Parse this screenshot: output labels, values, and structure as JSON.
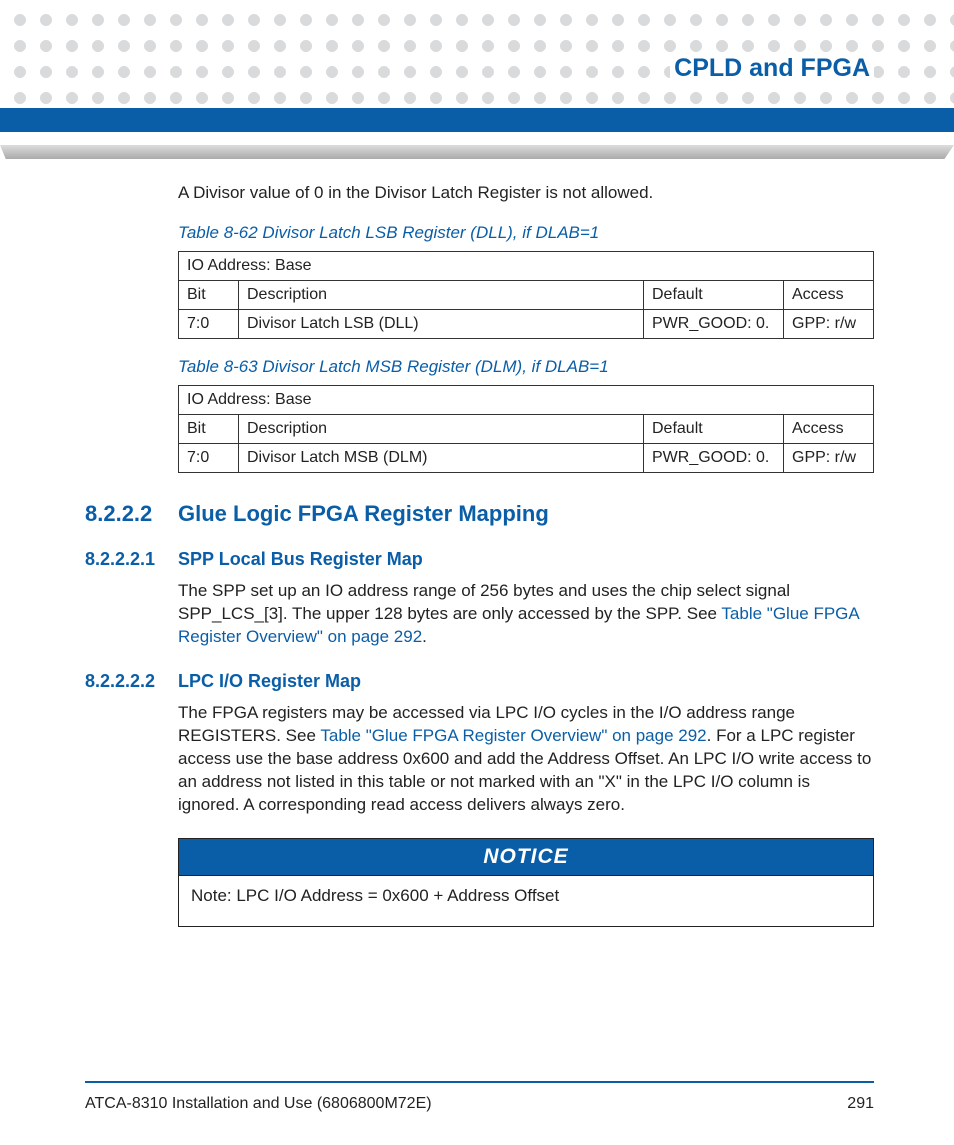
{
  "header": {
    "chapter": "CPLD and FPGA"
  },
  "intro": "A Divisor value of 0 in the Divisor Latch Register is not allowed.",
  "table62": {
    "caption": "Table 8-62 Divisor Latch LSB Register (DLL), if DLAB=1",
    "address_row": "IO Address: Base",
    "headers": {
      "bit": "Bit",
      "desc": "Description",
      "def": "Default",
      "acc": "Access"
    },
    "row": {
      "bit": "7:0",
      "desc": "Divisor Latch LSB (DLL)",
      "def": "PWR_GOOD: 0.",
      "acc": "GPP: r/w"
    }
  },
  "table63": {
    "caption": "Table 8-63 Divisor Latch MSB Register (DLM), if DLAB=1",
    "address_row": "IO Address: Base",
    "headers": {
      "bit": "Bit",
      "desc": "Description",
      "def": "Default",
      "acc": "Access"
    },
    "row": {
      "bit": "7:0",
      "desc": "Divisor Latch MSB (DLM)",
      "def": "PWR_GOOD: 0.",
      "acc": "GPP: r/w"
    }
  },
  "sec8222": {
    "num": "8.2.2.2",
    "title": "Glue Logic FPGA Register Mapping"
  },
  "sec82221": {
    "num": "8.2.2.2.1",
    "title": "SPP Local Bus Register Map",
    "text1": "The SPP set up an IO address range of 256 bytes and uses the chip select signal SPP_LCS_[3]. The upper 128 bytes are only accessed by the SPP. See ",
    "link": "Table \"Glue FPGA Register Overview\" on page 292",
    "text2": "."
  },
  "sec82222": {
    "num": "8.2.2.2.2",
    "title": "LPC I/O Register Map",
    "text1": "The FPGA registers may be accessed via LPC I/O cycles in the I/O address range REGISTERS. See ",
    "link": "Table \"Glue FPGA Register Overview\" on page 292",
    "text2": ". For a LPC register access use the base address 0x600 and add the Address Offset. An LPC I/O write access to an address not listed in this table or not marked with an \"X\" in the LPC I/O column is ignored. A corresponding read access delivers always zero."
  },
  "notice": {
    "head": "NOTICE",
    "body": "Note: LPC I/O Address = 0x600 + Address Offset"
  },
  "footer": {
    "doc": "ATCA-8310 Installation and Use (6806800M72E)",
    "page": "291"
  }
}
